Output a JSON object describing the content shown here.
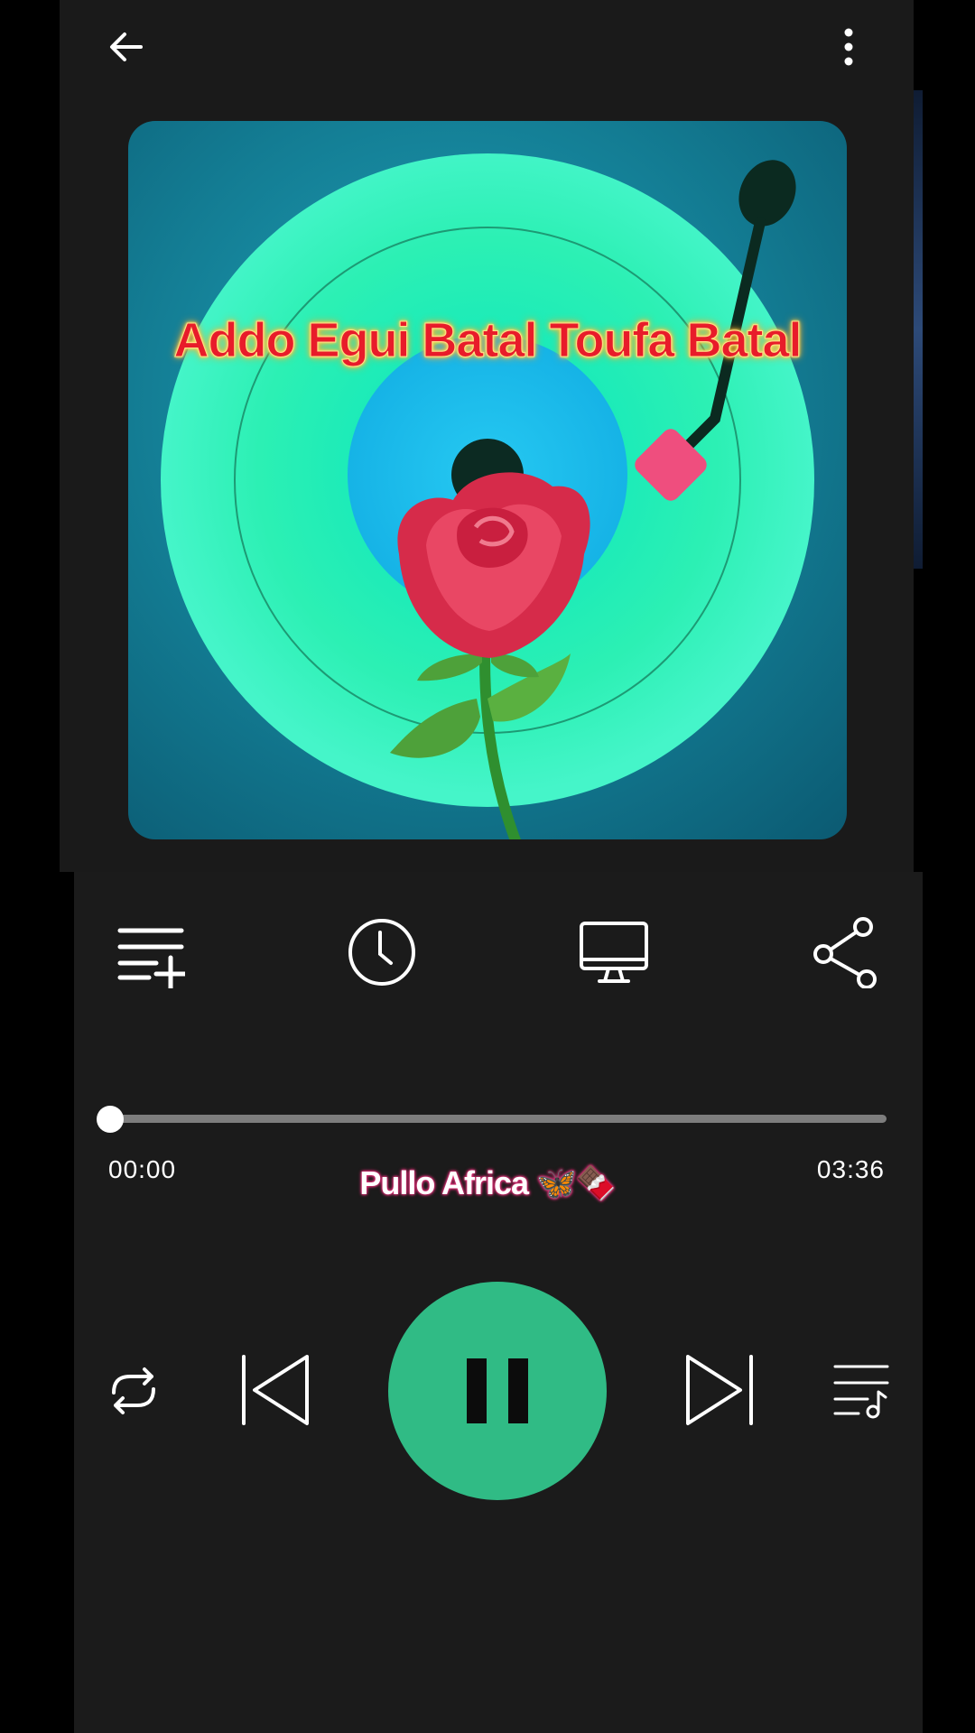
{
  "art": {
    "caption": "Addo Egui Batal Toufa Batal"
  },
  "player": {
    "elapsed": "00:00",
    "duration": "03:36",
    "artist": "Pullo Africa 🦋🍫",
    "progress": 0.0,
    "state": "playing"
  },
  "icons": {
    "back": "arrow-left-icon",
    "menu": "more-vertical-icon",
    "add_to_playlist": "playlist-add-icon",
    "sleep_timer": "clock-icon",
    "cast": "monitor-icon",
    "share": "share-icon",
    "repeat": "repeat-icon",
    "previous": "skip-previous-icon",
    "pause": "pause-icon",
    "next": "skip-next-icon",
    "queue": "queue-music-icon"
  },
  "colors": {
    "background": "#1b1b1b",
    "accent": "#30bb85",
    "caption": "#e81c2a",
    "artist_glow": "#e5307a"
  }
}
